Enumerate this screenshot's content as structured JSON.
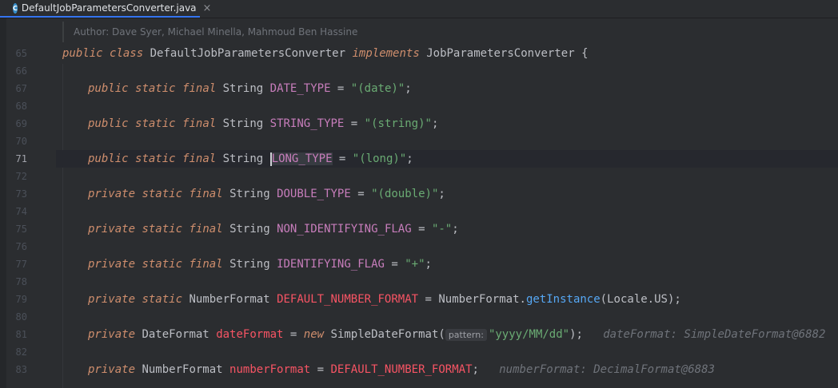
{
  "tab": {
    "filename": "DefaultJobParametersConverter.java",
    "close_glyph": "×",
    "icon": "class-file-icon",
    "icon_letter": "C"
  },
  "doc_comment": "Author: Dave Syer, Michael Minella, Mahmoud Ben Hassine",
  "lines": [
    {
      "num": "65"
    },
    {
      "num": "66"
    },
    {
      "num": "67"
    },
    {
      "num": "68"
    },
    {
      "num": "69"
    },
    {
      "num": "70"
    },
    {
      "num": "71"
    },
    {
      "num": "72"
    },
    {
      "num": "73"
    },
    {
      "num": "74"
    },
    {
      "num": "75"
    },
    {
      "num": "76"
    },
    {
      "num": "77"
    },
    {
      "num": "78"
    },
    {
      "num": "79"
    },
    {
      "num": "80"
    },
    {
      "num": "81"
    },
    {
      "num": "82"
    },
    {
      "num": "83"
    }
  ],
  "t": {
    "public": "public",
    "private": "private",
    "static": "static",
    "final": "final",
    "class": "class",
    "implements": "implements",
    "new": "new",
    "String": "String",
    "NumberFormat": "NumberFormat",
    "DateFormat": "DateFormat",
    "eq": " = ",
    "semi": ";",
    "cls_name": "DefaultJobParametersConverter",
    "iface": "JobParametersConverter",
    "brace": " {",
    "DATE_TYPE": "DATE_TYPE",
    "date_val": "\"(date)\"",
    "STRING_TYPE": "STRING_TYPE",
    "string_val": "\"(string)\"",
    "LONG_TYPE": "LONG_TYPE",
    "long_val": "\"(long)\"",
    "DOUBLE_TYPE": "DOUBLE_TYPE",
    "double_val": "\"(double)\"",
    "NON_ID": "NON_IDENTIFYING_FLAG",
    "nonid_val": "\"-\"",
    "ID": "IDENTIFYING_FLAG",
    "id_val": "\"+\"",
    "DNF": "DEFAULT_NUMBER_FORMAT",
    "NumberFormat_dot": "NumberFormat.",
    "getInstance": "getInstance",
    "locale_arg": "(Locale.US);",
    "dateFormat": "dateFormat",
    "SimpleDateFormat": "SimpleDateFormat(",
    "pattern_hint": "pattern:",
    "pattern_val": "\"yyyy/MM/dd\"",
    "close_paren": ");",
    "inlay1": "dateFormat: SimpleDateFormat@6882",
    "numberFormat": "numberFormat",
    "inlay2": "numberFormat: DecimalFormat@6883"
  }
}
